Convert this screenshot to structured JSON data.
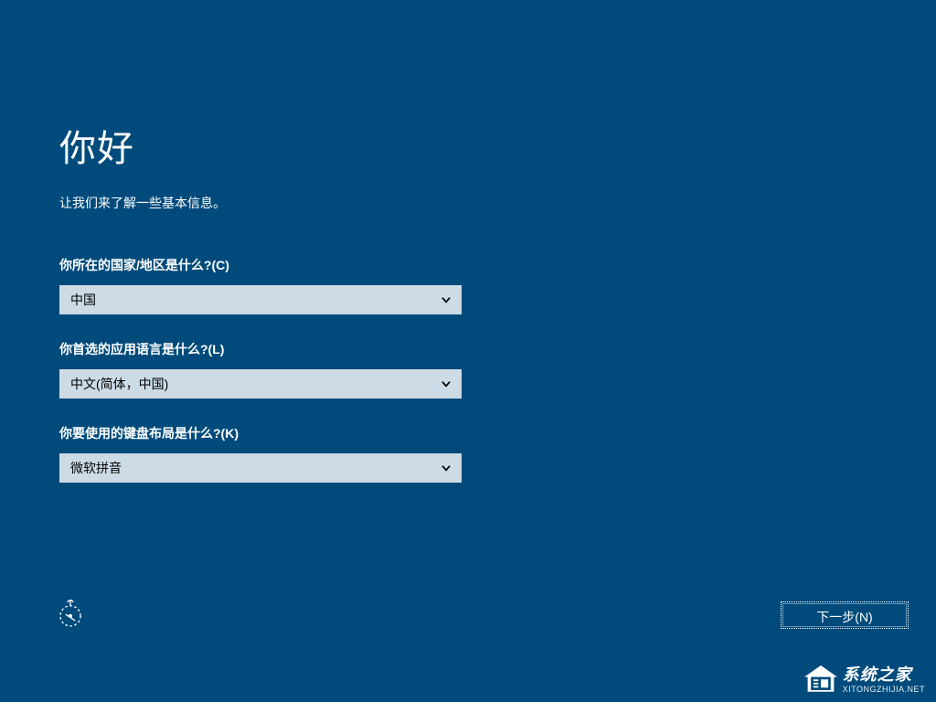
{
  "header": {
    "title": "你好",
    "subtitle": "让我们来了解一些基本信息。"
  },
  "form": {
    "country": {
      "label": "你所在的国家/地区是什么?(C)",
      "value": "中国"
    },
    "language": {
      "label": "你首选的应用语言是什么?(L)",
      "value": "中文(简体，中国)"
    },
    "keyboard": {
      "label": "你要使用的键盘布局是什么?(K)",
      "value": "微软拼音"
    }
  },
  "footer": {
    "next_label": "下一步(N)"
  },
  "watermark": {
    "main": "系统之家",
    "sub": "XITONGZHIJIA.NET"
  }
}
